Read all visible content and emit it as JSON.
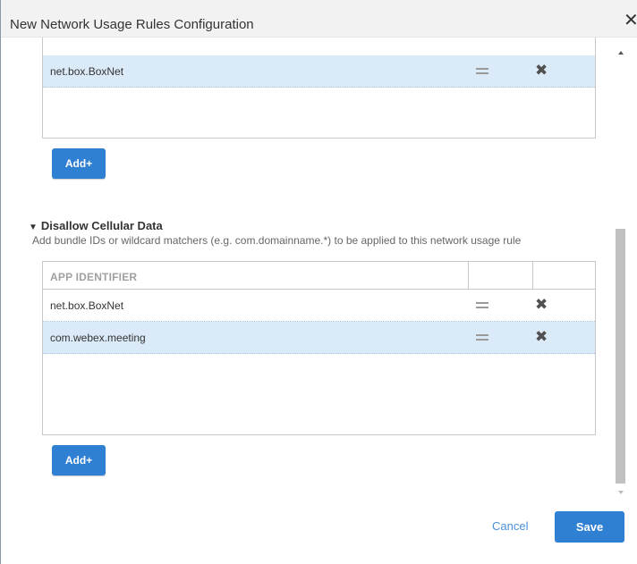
{
  "dialog": {
    "title": "New Network Usage Rules Configuration",
    "close_glyph": "✕"
  },
  "upper_list": {
    "rows": [
      {
        "app_id": "net.box.BoxNet",
        "selected": true
      }
    ],
    "add_label": "Add+"
  },
  "disallow_cellular": {
    "toggle_glyph": "▼",
    "title": "Disallow Cellular Data",
    "description": "Add bundle IDs or wildcard matchers (e.g. com.domainname.*) to be applied to this network usage rule",
    "column_header": "APP IDENTIFIER",
    "rows": [
      {
        "app_id": "net.box.BoxNet",
        "selected": false
      },
      {
        "app_id": "com.webex.meeting",
        "selected": true
      }
    ],
    "add_label": "Add+"
  },
  "row_actions": {
    "reorder_icon": "drag-handle-icon",
    "delete_glyph": "✖"
  },
  "footer": {
    "cancel_label": "Cancel",
    "save_label": "Save"
  },
  "colors": {
    "accent": "#2f7fd3",
    "selected_row": "#dbeaf8",
    "link": "#4a90d9"
  }
}
